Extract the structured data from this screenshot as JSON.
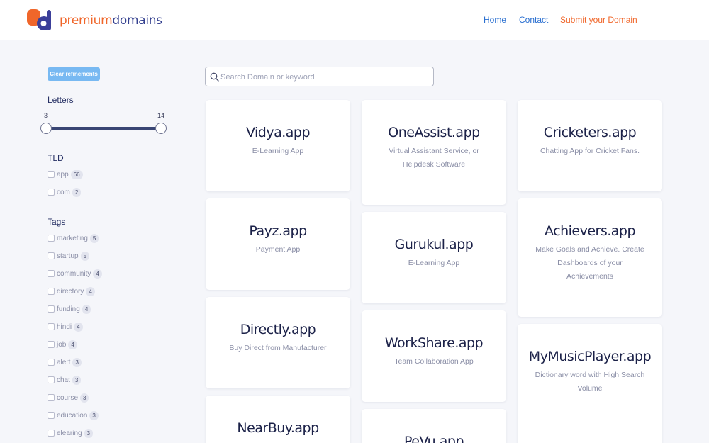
{
  "header": {
    "brand_part1": "premium",
    "brand_part2": "domains",
    "nav": {
      "home": "Home",
      "contact": "Contact",
      "submit": "Submit your Domain"
    }
  },
  "sidebar": {
    "clear_label": "Clear refinements",
    "letters": {
      "title": "Letters",
      "min": "3",
      "max": "14"
    },
    "tld": {
      "title": "TLD",
      "items": [
        {
          "label": "app",
          "count": "66"
        },
        {
          "label": "com",
          "count": "2"
        }
      ]
    },
    "tags": {
      "title": "Tags",
      "items": [
        {
          "label": "marketing",
          "count": "5"
        },
        {
          "label": "startup",
          "count": "5"
        },
        {
          "label": "community",
          "count": "4"
        },
        {
          "label": "directory",
          "count": "4"
        },
        {
          "label": "funding",
          "count": "4"
        },
        {
          "label": "hindi",
          "count": "4"
        },
        {
          "label": "job",
          "count": "4"
        },
        {
          "label": "alert",
          "count": "3"
        },
        {
          "label": "chat",
          "count": "3"
        },
        {
          "label": "course",
          "count": "3"
        },
        {
          "label": "education",
          "count": "3"
        },
        {
          "label": "elearing",
          "count": "3"
        }
      ]
    }
  },
  "search": {
    "placeholder": "Search Domain or keyword",
    "value": ""
  },
  "domains": [
    {
      "name": "Vidya.app",
      "desc": "E-Learning App"
    },
    {
      "name": "Payz.app",
      "desc": "Payment App"
    },
    {
      "name": "Directly.app",
      "desc": "Buy Direct from Manufacturer"
    },
    {
      "name": "NearBuy.app",
      "desc": ""
    },
    {
      "name": "OneAssist.app",
      "desc": "Virtual Assistant Service, or Helpdesk Software"
    },
    {
      "name": "Gurukul.app",
      "desc": "E-Learning App"
    },
    {
      "name": "WorkShare.app",
      "desc": "Team Collaboration App"
    },
    {
      "name": "PeVu.app",
      "desc": ""
    },
    {
      "name": "Cricketers.app",
      "desc": "Chatting App for Cricket Fans."
    },
    {
      "name": "Achievers.app",
      "desc": "Make Goals and Achieve. Create Dashboards of your Achievements"
    },
    {
      "name": "MyMusicPlayer.app",
      "desc": "Dictionary word with High Search Volume"
    }
  ],
  "colors": {
    "accent": "#f0662a",
    "brand_blue": "#34408f",
    "link": "#2a6fd0",
    "button": "#78b9f2"
  }
}
